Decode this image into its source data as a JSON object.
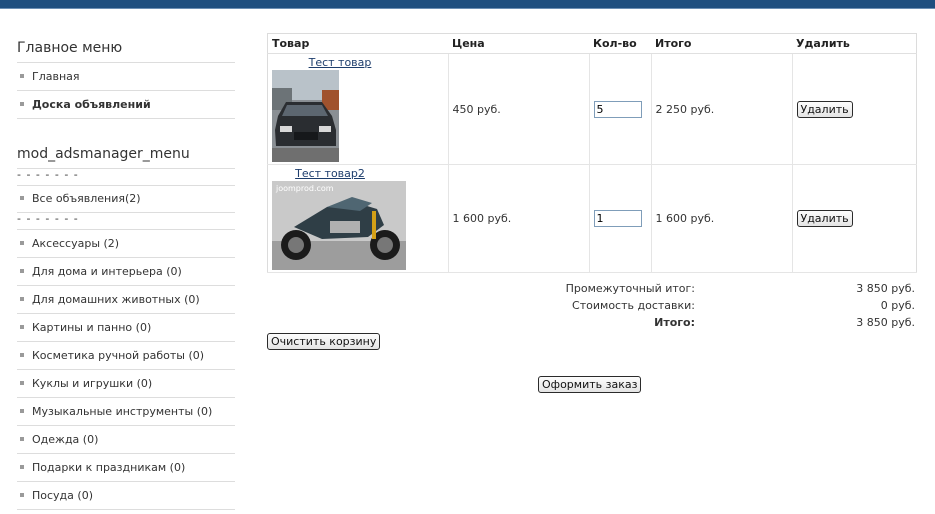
{
  "main_menu": {
    "title": "Главное меню",
    "items": [
      {
        "label": "Главная",
        "bold": false
      },
      {
        "label": "Доска объявлений",
        "bold": true
      }
    ]
  },
  "ads_menu": {
    "title": "mod_adsmanager_menu",
    "separator": "- - - - - - -",
    "all_ads": "Все объявления(2)",
    "categories": [
      "Аксессуары (2)",
      "Для дома и интерьера (0)",
      "Для домашних животных (0)",
      "Картины и панно (0)",
      "Косметика ручной работы (0)",
      "Куклы и игрушки (0)",
      "Музыкальные инструменты (0)",
      "Одежда (0)",
      "Подарки к праздникам (0)",
      "Посуда (0)"
    ]
  },
  "cart": {
    "headers": {
      "product": "Товар",
      "price": "Цена",
      "qty": "Кол-во",
      "total": "Итого",
      "delete": "Удалить"
    },
    "rows": [
      {
        "name": "Тест товар",
        "price": "450 руб.",
        "qty": "5",
        "total": "2 250 руб.",
        "delete_label": "Удалить",
        "image": "car-photo"
      },
      {
        "name": "Тест товар2",
        "price": "1 600 руб.",
        "qty": "1",
        "total": "1 600 руб.",
        "delete_label": "Удалить",
        "image": "motorcycle-photo",
        "watermark": "joomprod.com"
      }
    ]
  },
  "totals": {
    "subtotal_label": "Промежуточный итог:",
    "subtotal_value": "3 850 руб.",
    "shipping_label": "Стоимость доставки:",
    "shipping_value": "0 руб.",
    "total_label": "Итого:",
    "total_value": "3 850 руб."
  },
  "buttons": {
    "clear_cart": "Очистить корзину",
    "checkout": "Оформить заказ"
  },
  "colors": {
    "topbar": "#1f4f7f",
    "link": "#1d3d6c"
  }
}
